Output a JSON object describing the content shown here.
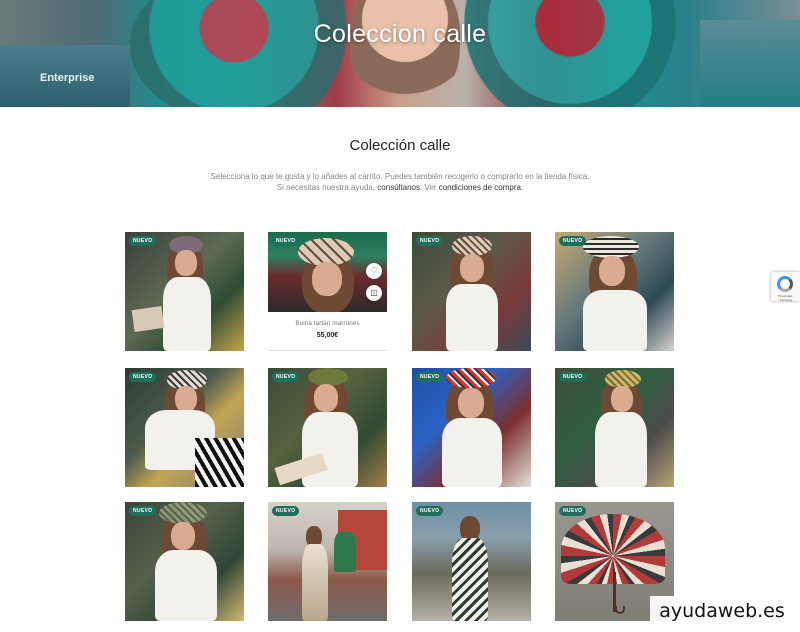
{
  "hero": {
    "title": "Coleccion calle",
    "truck_text": "Enterprise"
  },
  "section": {
    "title": "Colección calle",
    "intro_line1": "Selecciona lo que te gusta y lo añades al carrito. Puedes también recogerlo o comprarlo en la tienda física.",
    "intro_line2_pre": "Si necesitas nuestra ayuda, ",
    "intro_link1": "consúltanos",
    "intro_line2_mid": ". Ver ",
    "intro_link2": "condiciones de compra",
    "intro_line2_post": "."
  },
  "badge_label": "NUEVO",
  "products": [
    {
      "name": "",
      "price": ""
    },
    {
      "name": "Boina tartán marrones",
      "price": "55,00€"
    },
    {
      "name": "",
      "price": ""
    },
    {
      "name": "",
      "price": ""
    },
    {
      "name": "",
      "price": ""
    },
    {
      "name": "",
      "price": ""
    },
    {
      "name": "",
      "price": ""
    },
    {
      "name": "",
      "price": ""
    },
    {
      "name": "",
      "price": ""
    },
    {
      "name": "",
      "price": ""
    },
    {
      "name": "",
      "price": ""
    },
    {
      "name": "",
      "price": ""
    }
  ],
  "icons": {
    "wishlist": "heart-icon",
    "cart": "bag-icon"
  },
  "recaptcha": {
    "label": "Privacidad - Términos"
  },
  "watermark": "ayudaweb.es",
  "colors": {
    "badge": "#1f6f5c",
    "hero_teal": "#2aa3a0",
    "hero_red": "#a33a46"
  }
}
